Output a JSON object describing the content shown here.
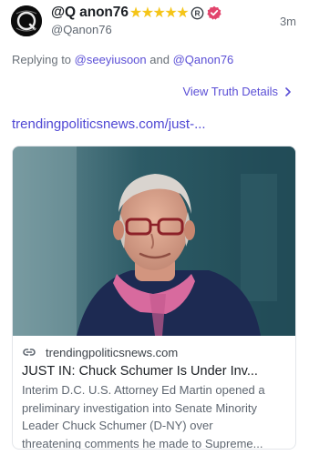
{
  "post": {
    "author": {
      "display_name": "@Q anon76",
      "stars": "★★★★★",
      "handle": "@Qanon76",
      "avatar_icon": "q-logo-avatar",
      "badges": [
        "registered-icon",
        "verified-badge-icon"
      ]
    },
    "timestamp": "3m",
    "replying_prefix": "Replying to",
    "replying_mention_1": "@seeyiusoon",
    "replying_and": "and",
    "replying_mention_2": "@Qanon76",
    "view_details_label": "View Truth Details",
    "link_text": "trendingpoliticsnews.com/just-...",
    "colors": {
      "accent": "#5b4fd6",
      "star": "#f5c518",
      "verified": "#e2446c"
    }
  },
  "card": {
    "image_alt": "photo-of-man-with-glasses",
    "domain": "trendingpoliticsnews.com",
    "title": "JUST IN: Chuck Schumer Is Under Inv...",
    "description_lines": [
      "Interim D.C. U.S. Attorney Ed Martin opened a",
      "preliminary investigation into Senate Minority",
      "Leader Chuck Schumer (D-NY) over",
      "threatening comments he made to Supreme..."
    ]
  }
}
